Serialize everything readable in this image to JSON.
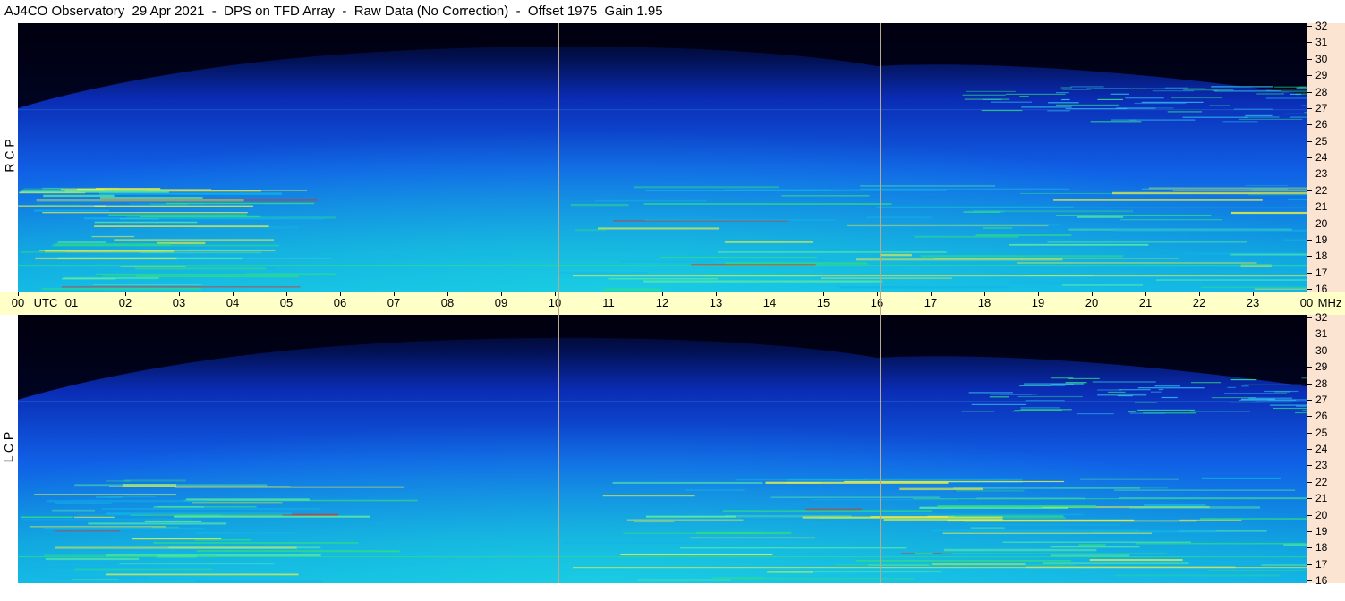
{
  "title": "AJ4CO Observatory  29 Apr 2021  -  DPS on TFD Array  -  Raw Data (No Correction)  -  Offset 1975  Gain 1.95",
  "panels": [
    {
      "polarization": "R C P",
      "name": "rcp"
    },
    {
      "polarization": "L C P",
      "name": "lcp"
    }
  ],
  "freq_axis": {
    "unit": "MHz",
    "ticks": [
      "32",
      "31",
      "30",
      "29",
      "28",
      "27",
      "26",
      "25",
      "24",
      "23",
      "22",
      "21",
      "20",
      "19",
      "18",
      "17",
      "16"
    ]
  },
  "time_axis": {
    "unit": "UTC",
    "labels": [
      "00",
      "01",
      "02",
      "03",
      "04",
      "05",
      "06",
      "07",
      "08",
      "09",
      "10",
      "11",
      "12",
      "13",
      "14",
      "15",
      "16",
      "17",
      "18",
      "19",
      "20",
      "21",
      "22",
      "23",
      "00"
    ]
  },
  "colors": {
    "background_dark": "#000010",
    "deep_blue": "#0a2cb4",
    "mid_blue": "#1060e6",
    "cyan": "#12b4e6",
    "green": "#30e080",
    "yellow": "#f0f040",
    "red": "#e03020",
    "time_axis_bg": "#ffffc8",
    "freq_axis_bg": "#fce4d2",
    "marker": "#b9a88c"
  },
  "markers_utc": [
    "10",
    "16"
  ]
}
